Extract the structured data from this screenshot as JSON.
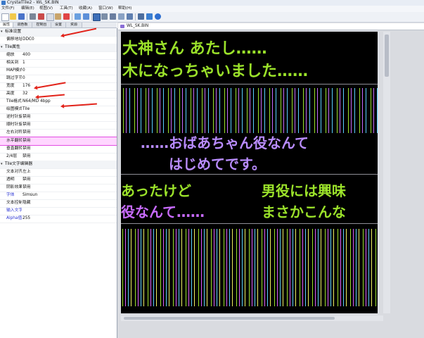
{
  "window": {
    "title": "CrystalTile2 - WL_SK.BIN"
  },
  "menu": [
    "文件(F)",
    "编辑(E)",
    "视图(V)",
    "工具(T)",
    "收藏(A)",
    "窗口(W)",
    "帮助(H)"
  ],
  "panel_tabs": [
    "属性",
    "调色板",
    "控制台",
    "设置",
    "资源"
  ],
  "properties": [
    {
      "type": "group",
      "label": "标准设置"
    },
    {
      "type": "item",
      "key": "偏移地址",
      "value": "DDC0"
    },
    {
      "type": "group",
      "label": "Tile属性"
    },
    {
      "type": "item",
      "key": "缩放",
      "value": "400"
    },
    {
      "type": "item",
      "key": "相关到",
      "value": "1"
    },
    {
      "type": "item",
      "key": "MAP模式",
      "value": "0"
    },
    {
      "type": "item",
      "key": "跳过字节",
      "value": "0"
    },
    {
      "type": "item",
      "key": "宽度",
      "value": "176"
    },
    {
      "type": "item",
      "key": "高度",
      "value": "32"
    },
    {
      "type": "item",
      "key": "Tile格式",
      "value": "N64/MD 4bpp"
    },
    {
      "type": "item",
      "key": "绘图模式",
      "value": "Tile"
    },
    {
      "type": "item",
      "key": "逆时针旋转",
      "value": "禁用"
    },
    {
      "type": "item",
      "key": "顺时针旋转",
      "value": "禁用"
    },
    {
      "type": "item",
      "key": "左右对称",
      "value": "禁用"
    },
    {
      "type": "item",
      "key": "水平翻转",
      "value": "禁用",
      "highlight": true
    },
    {
      "type": "item",
      "key": "垂直翻转",
      "value": "禁用"
    },
    {
      "type": "item",
      "key": "2/4层",
      "value": "禁用"
    },
    {
      "type": "group",
      "label": "Tile文字编辑器"
    },
    {
      "type": "item",
      "key": "文本对齐",
      "value": "左上"
    },
    {
      "type": "item",
      "key": "透明",
      "value": "禁用"
    },
    {
      "type": "item",
      "key": "阴影效果",
      "value": "禁用"
    },
    {
      "type": "item",
      "key": "字体",
      "value": "Simsun",
      "blue": true
    },
    {
      "type": "item",
      "key": "文本控制",
      "value": "隐藏"
    },
    {
      "type": "item",
      "key": "输入文字",
      "value": "",
      "blue": true
    },
    {
      "type": "item",
      "key": "Alpha值",
      "value": "255",
      "blue": true
    }
  ],
  "document": {
    "tab_title": "WL_SK.BIN"
  },
  "canvas": {
    "lines": [
      {
        "text": "大神さん あたし……",
        "color": "#9be22a"
      },
      {
        "text": "木になっちゃいました……",
        "color": "#9be22a"
      },
      {
        "text": "……おばあちゃん役なんて",
        "color": "#b98cff"
      },
      {
        "text": "はじめてです。",
        "color": "#b98cff"
      },
      {
        "text": "あったけど",
        "color": "#9be22a"
      },
      {
        "text": "男役には興味",
        "color": "#9be22a"
      },
      {
        "text": "役なんて……",
        "color": "#c86bff"
      },
      {
        "text": "まさかこんな",
        "color": "#9be22a"
      }
    ]
  },
  "colors": {
    "accent": "#e2231a",
    "highlight": "#ffd6ff",
    "link": "#2a34d4"
  },
  "icons": [
    "new-file-icon",
    "open-folder-icon",
    "save-icon",
    "cut-icon",
    "copy-icon",
    "paste-icon",
    "delete-icon",
    "find-icon",
    "tile-view-icon",
    "palette-icon",
    "help-icon"
  ]
}
